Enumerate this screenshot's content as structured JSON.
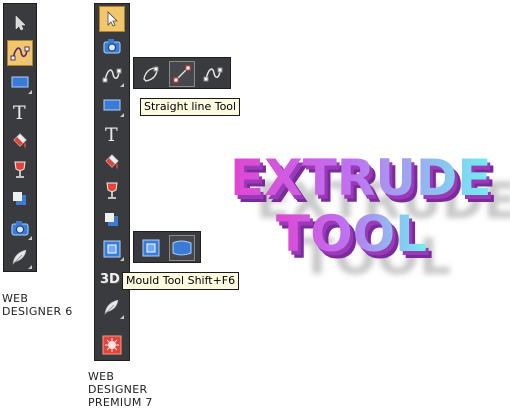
{
  "toolbar_wd6": {
    "tools": [
      "selector-tool",
      "shape-editor-tool",
      "rectangle-tool",
      "text-tool",
      "fill-tool",
      "transparency-tool",
      "shadow-tool",
      "photo-tool",
      "feather-tool"
    ],
    "caption": [
      "WEB",
      "DESIGNER 6"
    ]
  },
  "toolbar_wdp7": {
    "tools": [
      "selector-tool",
      "photo-tool",
      "shape-editor-tool",
      "rectangle-tool",
      "text-tool",
      "fill-tool",
      "transparency-tool",
      "shadow-tool",
      "mould-tool",
      "extrude-3d-tool",
      "feather-tool",
      "live-effects-tool"
    ],
    "caption": [
      "WEB",
      "DESIGNER",
      "PREMIUM 7"
    ]
  },
  "flyout_line": {
    "tooltip": "Straight line Tool",
    "tools": [
      "pen-tool",
      "straight-line-tool",
      "shape-editor-tool"
    ]
  },
  "flyout_mould": {
    "tooltip": "Mould Tool  Shift+F6",
    "tools": [
      "envelope-tool",
      "perspective-tool"
    ]
  },
  "extrude_label": {
    "line1": "EXTRUDE",
    "line2": "TOOL"
  },
  "colors": {
    "toolbar_bg": "#3a3b3e",
    "active_tool": "#f2c66c",
    "tooltip_bg": "#fffbe0",
    "extrude_magenta": "#e03cc8",
    "extrude_cyan": "#6ff0f0"
  }
}
